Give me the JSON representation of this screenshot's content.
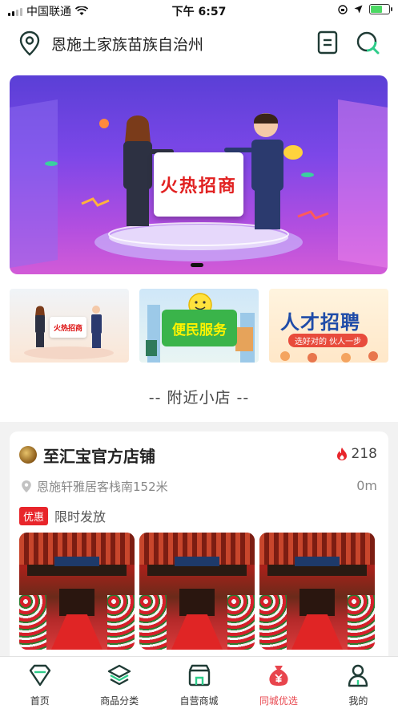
{
  "status_bar": {
    "carrier": "中国联通",
    "time": "下午 6:57"
  },
  "header": {
    "city": "恩施土家族苗族自治州",
    "icons": [
      "location-pin-icon",
      "list-icon",
      "search-icon"
    ]
  },
  "banner": {
    "sign_text": "火热招商",
    "current_page": 1
  },
  "quick_links": [
    {
      "name": "investment",
      "text": "火热招商"
    },
    {
      "name": "convenience-service",
      "text": "便民服务"
    },
    {
      "name": "talent-recruit",
      "title": "人才招聘",
      "subtitle": "选好对的  伙人一步"
    }
  ],
  "section": {
    "title": "-- 附近小店 --"
  },
  "shop": {
    "name": "至汇宝官方店铺",
    "hot_count": "218",
    "address": "恩施轩雅居客栈南152米",
    "distance": "0m",
    "promo_tag": "优惠",
    "promo_text": "限时发放",
    "gallery_count": 3
  },
  "tabbar": {
    "items": [
      {
        "label": "首页",
        "icon": "diamond-home-icon"
      },
      {
        "label": "商品分类",
        "icon": "layers-icon"
      },
      {
        "label": "自营商城",
        "icon": "store-icon"
      },
      {
        "label": "同城优选",
        "icon": "money-bag-icon"
      },
      {
        "label": "我的",
        "icon": "user-icon"
      }
    ],
    "active_index": 3,
    "accent_color": "#e8454d"
  },
  "colors": {
    "primary_dark": "#1f3b35",
    "accent_red": "#e8252b"
  }
}
